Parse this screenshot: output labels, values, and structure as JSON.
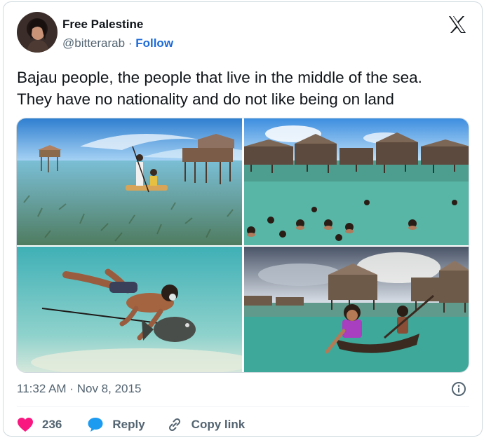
{
  "author": {
    "name": "Free Palestine",
    "handle": "@bitterarab",
    "separator": "·",
    "follow_label": "Follow"
  },
  "tweet": {
    "text_line1": "Bajau people, the people that live in the middle of the sea.",
    "text_line2": "They have no nationality and do not like being on land"
  },
  "media": {
    "photos": [
      "stilt-houses-and-boat-on-clear-shallow-water",
      "children-swimming-near-stilt-village",
      "free-diver-spearfishing-underwater",
      "girl-in-wooden-canoe-near-stilt-houses"
    ]
  },
  "meta": {
    "time": "11:32 AM",
    "separator": "·",
    "date": "Nov 8, 2015"
  },
  "actions": {
    "like_count": "236",
    "reply_label": "Reply",
    "copy_label": "Copy link"
  },
  "colors": {
    "text": "#0f1419",
    "secondary": "#536471",
    "link": "#1d6ad8",
    "like": "#f91880",
    "reply_icon": "#1d9bf0",
    "border": "#cfd9de"
  },
  "icons": {
    "brand": "x-logo-icon",
    "info": "info-icon",
    "like": "heart-icon",
    "reply": "speech-bubble-icon",
    "copy": "link-icon"
  }
}
